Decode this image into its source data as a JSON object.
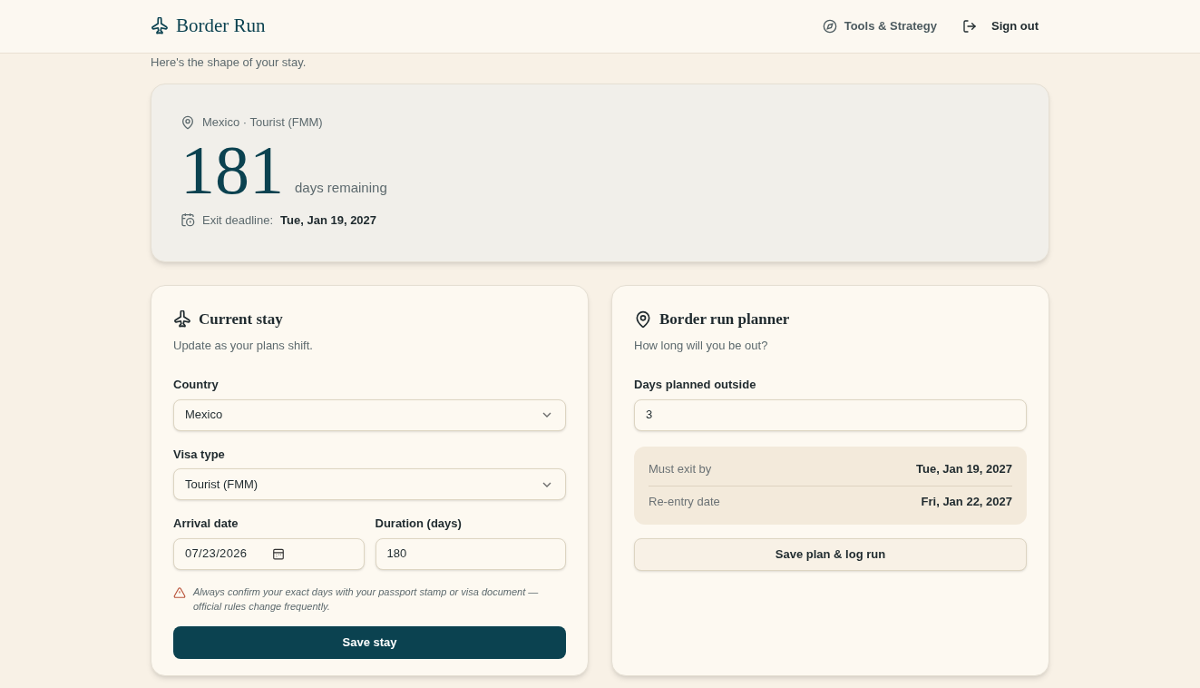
{
  "header": {
    "brand": "Border Run",
    "nav": [
      {
        "label": "Tools & Strategy",
        "kind": "compass"
      },
      {
        "label": "Sign out",
        "kind": "logout"
      }
    ]
  },
  "subtitle": "Here's the shape of your stay.",
  "summary": {
    "location": "Mexico · Tourist (FMM)",
    "days": "181",
    "days_label": "days remaining",
    "deadline_label": "Exit deadline:",
    "deadline": "Tue, Jan 19, 2027"
  },
  "current_stay": {
    "title": "Current stay",
    "subtitle": "Update as your plans shift.",
    "country": {
      "label": "Country",
      "value": "Mexico"
    },
    "visa": {
      "label": "Visa type",
      "value": "Tourist (FMM)"
    },
    "arrival": {
      "label": "Arrival date",
      "value": "07/23/2026"
    },
    "duration": {
      "label": "Duration (days)",
      "value": "180"
    },
    "warning": "Always confirm your exact days with your passport stamp or visa document — official rules change frequently.",
    "button": "Save stay"
  },
  "planner": {
    "title": "Border run planner",
    "subtitle": "How long will you be out?",
    "days": {
      "label": "Days planned outside",
      "value": "3"
    },
    "results": [
      {
        "label": "Must exit by",
        "value": "Tue, Jan 19, 2027"
      },
      {
        "label": "Re-entry date",
        "value": "Fri, Jan 22, 2027"
      }
    ],
    "button": "Save plan & log run"
  }
}
